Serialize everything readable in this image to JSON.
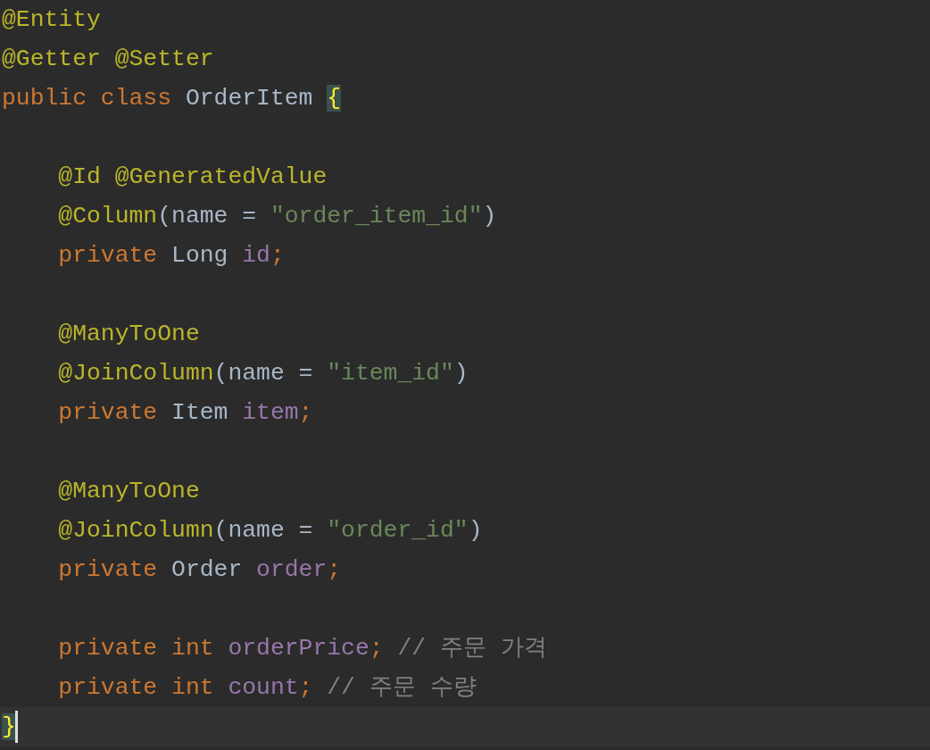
{
  "editor": {
    "lines": [
      {
        "kind": "code",
        "current": false,
        "tokens": [
          {
            "kind": "annotation",
            "text": "@Entity"
          }
        ]
      },
      {
        "kind": "code",
        "current": false,
        "tokens": [
          {
            "kind": "annotation",
            "text": "@Getter @Setter"
          }
        ]
      },
      {
        "kind": "code",
        "current": false,
        "tokens": [
          {
            "kind": "keyword",
            "text": "public class "
          },
          {
            "kind": "plain",
            "text": "OrderItem "
          },
          {
            "kind": "brace",
            "text": "{",
            "matched": true
          }
        ]
      },
      {
        "kind": "blank"
      },
      {
        "kind": "code",
        "current": false,
        "tokens": [
          {
            "kind": "annotation",
            "text": "    @Id @GeneratedValue"
          }
        ]
      },
      {
        "kind": "code",
        "current": false,
        "tokens": [
          {
            "kind": "annotation",
            "text": "    @Column"
          },
          {
            "kind": "plain",
            "text": "(name = "
          },
          {
            "kind": "string",
            "text": "\"order_item_id\""
          },
          {
            "kind": "plain",
            "text": ")"
          }
        ]
      },
      {
        "kind": "code",
        "current": false,
        "tokens": [
          {
            "kind": "keyword",
            "text": "    private "
          },
          {
            "kind": "plain",
            "text": "Long "
          },
          {
            "kind": "field",
            "text": "id"
          },
          {
            "kind": "keyword",
            "text": ";"
          }
        ]
      },
      {
        "kind": "blank"
      },
      {
        "kind": "code",
        "current": false,
        "tokens": [
          {
            "kind": "annotation",
            "text": "    @ManyToOne"
          }
        ]
      },
      {
        "kind": "code",
        "current": false,
        "tokens": [
          {
            "kind": "annotation",
            "text": "    @JoinColumn"
          },
          {
            "kind": "plain",
            "text": "(name = "
          },
          {
            "kind": "string",
            "text": "\"item_id\""
          },
          {
            "kind": "plain",
            "text": ")"
          }
        ]
      },
      {
        "kind": "code",
        "current": false,
        "tokens": [
          {
            "kind": "keyword",
            "text": "    private "
          },
          {
            "kind": "plain",
            "text": "Item "
          },
          {
            "kind": "field",
            "text": "item"
          },
          {
            "kind": "keyword",
            "text": ";"
          }
        ]
      },
      {
        "kind": "blank"
      },
      {
        "kind": "code",
        "current": false,
        "tokens": [
          {
            "kind": "annotation",
            "text": "    @ManyToOne"
          }
        ]
      },
      {
        "kind": "code",
        "current": false,
        "tokens": [
          {
            "kind": "annotation",
            "text": "    @JoinColumn"
          },
          {
            "kind": "plain",
            "text": "(name = "
          },
          {
            "kind": "string",
            "text": "\"order_id\""
          },
          {
            "kind": "plain",
            "text": ")"
          }
        ]
      },
      {
        "kind": "code",
        "current": false,
        "tokens": [
          {
            "kind": "keyword",
            "text": "    private "
          },
          {
            "kind": "plain",
            "text": "Order "
          },
          {
            "kind": "field",
            "text": "order"
          },
          {
            "kind": "keyword",
            "text": ";"
          }
        ]
      },
      {
        "kind": "blank"
      },
      {
        "kind": "code",
        "current": false,
        "tokens": [
          {
            "kind": "keyword",
            "text": "    private int "
          },
          {
            "kind": "field",
            "text": "orderPrice"
          },
          {
            "kind": "keyword",
            "text": "; "
          },
          {
            "kind": "comment",
            "text": "// 주문 가격"
          }
        ]
      },
      {
        "kind": "code",
        "current": false,
        "tokens": [
          {
            "kind": "keyword",
            "text": "    private int "
          },
          {
            "kind": "field",
            "text": "count"
          },
          {
            "kind": "keyword",
            "text": "; "
          },
          {
            "kind": "comment",
            "text": "// 주문 수량"
          }
        ]
      },
      {
        "kind": "code",
        "current": true,
        "tokens": [
          {
            "kind": "brace",
            "text": "}",
            "matched": true
          }
        ]
      }
    ]
  }
}
